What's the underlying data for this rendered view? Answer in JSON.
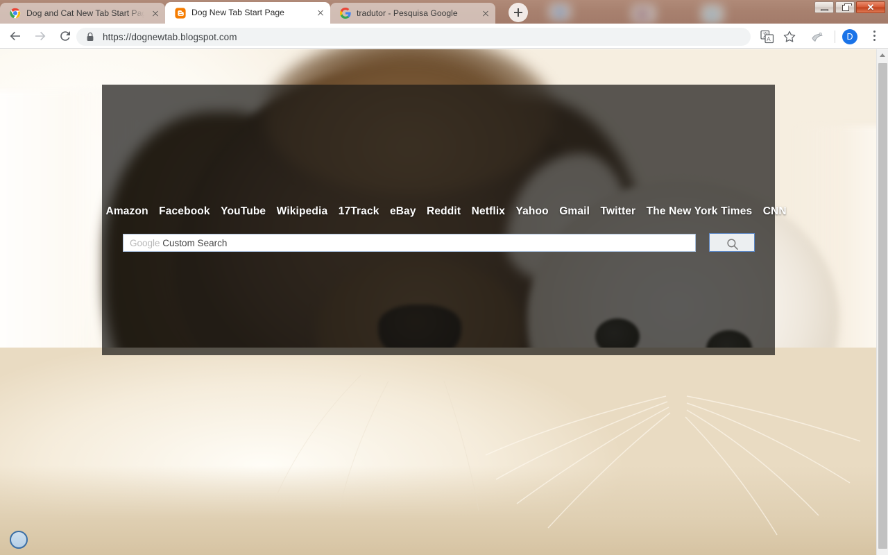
{
  "window": {
    "controls": [
      {
        "name": "minimize",
        "glyph": "—"
      },
      {
        "name": "maximize",
        "glyph": "❐"
      },
      {
        "name": "close",
        "glyph": "✕"
      }
    ]
  },
  "browser": {
    "tabs": [
      {
        "title": "Dog and Cat New Tab Start Page",
        "favicon": "chrome-multicolor-icon",
        "active": false
      },
      {
        "title": "Dog New Tab Start Page",
        "favicon": "blogger-icon",
        "active": true
      },
      {
        "title": "tradutor - Pesquisa Google",
        "favicon": "google-g-icon",
        "active": false
      }
    ],
    "new_tab_label": "+",
    "toolbar": {
      "back_label": "Back",
      "forward_label": "Forward",
      "reload_label": "Reload",
      "url": "https://dognewtab.blogspot.com",
      "security_icon": "lock-icon",
      "translate_icon": "translate-icon",
      "bookmark_icon": "star-icon",
      "extension_icon": "extension-icon",
      "profile_initial": "D",
      "menu_icon": "three-dot-menu-icon"
    }
  },
  "page": {
    "title": "Dog New Tab Start Page",
    "quick_links": [
      "Amazon",
      "Facebook",
      "YouTube",
      "Wikipedia",
      "17Track",
      "eBay",
      "Reddit",
      "Netflix",
      "Yahoo",
      "Gmail",
      "Twitter",
      "The New York Times",
      "CNN"
    ],
    "search": {
      "placeholder_brand": "Google",
      "placeholder_rest": " Custom Search",
      "value": "",
      "button_icon": "search-icon"
    },
    "background": {
      "description": "Close-up photo of a brown cocker spaniel puppy lying beside a white long-haired cat",
      "overlay_color": "#1c1a18",
      "overlay_opacity": "0.72"
    },
    "chat_widget_icon": "chat-bubble-icon"
  },
  "colors": {
    "theme_tabstrip": "#a8816f",
    "accent_blue": "#1a73e8",
    "omnibox_bg": "#f1f3f4",
    "panel": "#4d4a47",
    "close_button": "#c0401c"
  },
  "scrollbar": {
    "up_arrow_icon": "chevron-up-icon",
    "thumb_label": "vertical-scroll-thumb"
  }
}
